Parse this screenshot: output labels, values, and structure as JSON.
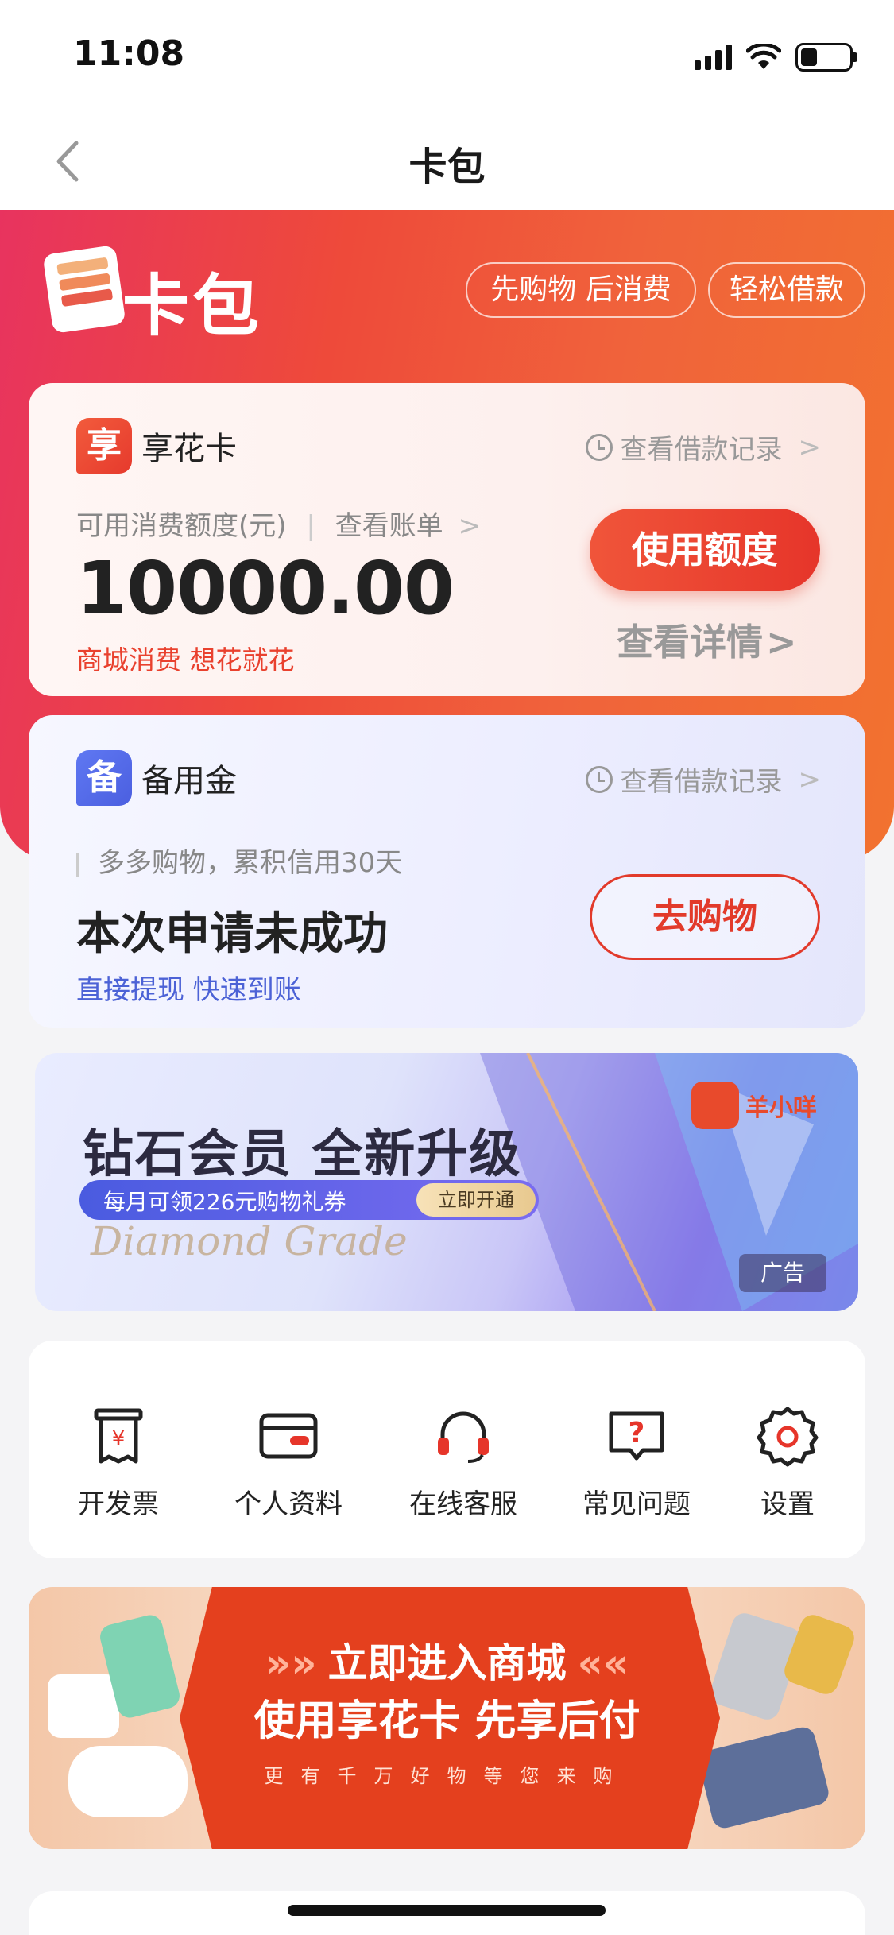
{
  "status_bar": {
    "time": "11:08"
  },
  "nav": {
    "title": "卡包"
  },
  "hero": {
    "title": "卡包",
    "pill_shop_first": "先购物 后消费",
    "pill_easy_loan": "轻松借款",
    "logo_text": "K...卡包"
  },
  "card_xianghua": {
    "badge": "享",
    "name": "享花卡",
    "loan_record": "查看借款记录",
    "available_label": "可用消费额度(元)",
    "view_bill": "查看账单",
    "amount": "10000.00",
    "tagline": "商城消费 想花就花",
    "use_button": "使用额度",
    "detail_link": "查看详情"
  },
  "card_beiyong": {
    "badge": "备",
    "name": "备用金",
    "loan_record": "查看借款记录",
    "subtitle": "多多购物，累积信用30天",
    "status": "本次申请未成功",
    "tagline": "直接提现 快速到账",
    "shop_button": "去购物"
  },
  "ad_banner": {
    "title": "钻石会员 全新升级",
    "pill_text": "每月可领226元购物礼券",
    "pill_button": "立即开通",
    "script_text": "Diamond Grade",
    "brand": "羊小咩",
    "ad_tag": "广告"
  },
  "quick_actions": [
    {
      "label": "开发票",
      "icon": "invoice-icon"
    },
    {
      "label": "个人资料",
      "icon": "id-card-icon"
    },
    {
      "label": "在线客服",
      "icon": "headset-icon"
    },
    {
      "label": "常见问题",
      "icon": "faq-icon"
    },
    {
      "label": "设置",
      "icon": "gear-icon"
    }
  ],
  "mall_banner": {
    "line1": "立即进入商城",
    "line2": "使用享花卡 先享后付",
    "line3": "更有千万好物等您来购"
  },
  "colors": {
    "accent_red": "#e6352a",
    "accent_blue": "#4c62d6",
    "hero_gradient_start": "#e8335f",
    "hero_gradient_end": "#f2722f"
  }
}
